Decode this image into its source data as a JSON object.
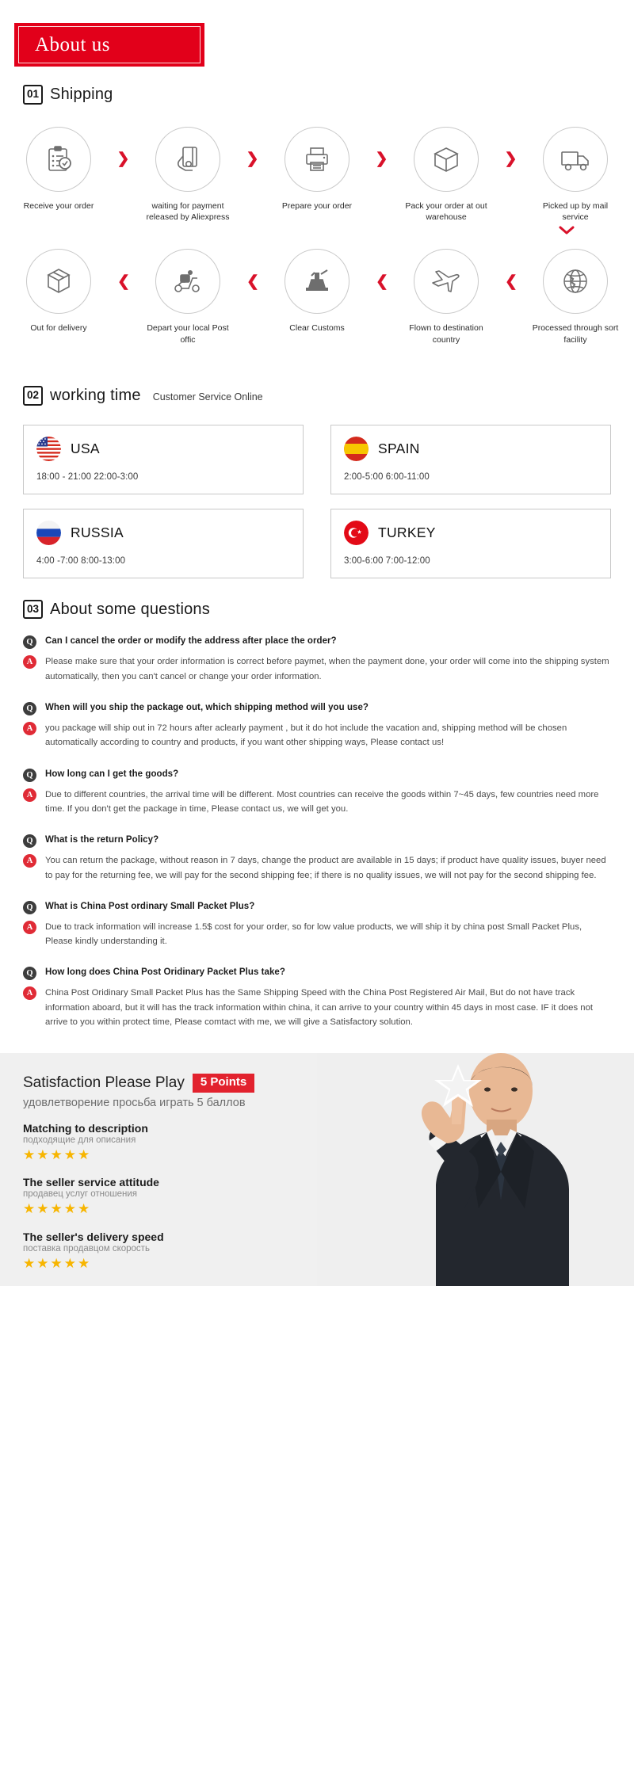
{
  "header": {
    "banner_title": "About us"
  },
  "shipping": {
    "number": "01",
    "title": "Shipping",
    "row1": [
      {
        "icon": "clipboard-check-icon",
        "label": "Receive your order"
      },
      {
        "icon": "hand-card-icon",
        "label": "waiting for payment released by Aliexpress"
      },
      {
        "icon": "printer-icon",
        "label": "Prepare your order"
      },
      {
        "icon": "box-icon",
        "label": "Pack your order at out warehouse"
      },
      {
        "icon": "truck-icon",
        "label": "Picked up by mail service"
      }
    ],
    "row2": [
      {
        "icon": "open-box-icon",
        "label": "Out  for delivery"
      },
      {
        "icon": "scooter-courier-icon",
        "label": "Depart your local Post offic"
      },
      {
        "icon": "customs-stamp-icon",
        "label": "Clear Customs"
      },
      {
        "icon": "airplane-icon",
        "label": "Flown to destination country"
      },
      {
        "icon": "globe-icon",
        "label": "Processed through sort facility"
      }
    ],
    "arrow_glyph": "❯",
    "down_arrow_glyph": "⌄"
  },
  "working_time": {
    "number": "02",
    "title": "working time",
    "subtitle": "Customer Service Online",
    "cards": [
      {
        "flag": "usa-flag-icon",
        "country": "USA",
        "hours": "18:00 - 21:00   22:00-3:00"
      },
      {
        "flag": "spain-flag-icon",
        "country": "SPAIN",
        "hours": "2:00-5:00     6:00-11:00"
      },
      {
        "flag": "russia-flag-icon",
        "country": "RUSSIA",
        "hours": "4:00 -7:00   8:00-13:00"
      },
      {
        "flag": "turkey-flag-icon",
        "country": "TURKEY",
        "hours": "3:00-6:00    7:00-12:00"
      }
    ]
  },
  "faq": {
    "number": "03",
    "title": "About some questions",
    "q_badge": "Q",
    "a_badge": "A",
    "items": [
      {
        "question": "Can I cancel the order or modify the address after place the order?",
        "answer": "Please make sure that your order information is correct before paymet, when the payment done, your order will come into the shipping system automatically, then you can't cancel or change your order information."
      },
      {
        "question": "When will you ship the package out, which shipping method will you use?",
        "answer": "you package will ship out in 72 hours after aclearly payment , but it do hot include the vacation and, shipping method will be chosen automatically according to country and products, if you want other shipping ways, Please contact us!"
      },
      {
        "question": "How long can I get the goods?",
        "answer": "Due to different countries, the arrival time will be different. Most countries can receive the goods within 7~45 days, few countries need more time. If you don't get the package in time, Please contact us, we will get you."
      },
      {
        "question": "What is the return Policy?",
        "answer": "You can return the package, without reason in 7 days, change the product are available in 15 days; if product have quality issues, buyer need to pay for the returning fee, we will pay for the second shipping fee; if there is no quality issues, we will not pay for the second shipping fee."
      },
      {
        "question": "What is China Post ordinary Small Packet Plus?",
        "answer": "Due to track information will increase 1.5$ cost for your order, so for low value products, we will ship it by china post Small Packet Plus, Please kindly understanding it."
      },
      {
        "question": "How long does China Post Oridinary Packet Plus take?",
        "answer": "China Post Oridinary Small Packet Plus has the Same Shipping Speed with the China Post Registered Air Mail, But do not have track information aboard, but it will has the track information within china, it can arrive to your country within 45 days in most case. IF it does not arrive to you within protect time, Please comtact with me, we will give a Satisfactory solution."
      }
    ]
  },
  "satisfaction": {
    "title": "Satisfaction Please Play",
    "points_badge": "5 Points",
    "subtitle": "удовлетворение просьба играть 5 баллов",
    "ratings": [
      {
        "en": "Matching to description",
        "ru": "подходящие для описания",
        "stars": "★★★★★"
      },
      {
        "en": "The seller service attitude",
        "ru": "продавец услуг отношения",
        "stars": "★★★★★"
      },
      {
        "en": "The seller's delivery speed",
        "ru": "поставка продавцом скорость",
        "stars": "★★★★★"
      }
    ]
  },
  "colors": {
    "brand_red": "#e2001a",
    "accent_red": "#d9112a",
    "star_gold": "#f7b500",
    "footer_bg": "#f0f0f0"
  }
}
